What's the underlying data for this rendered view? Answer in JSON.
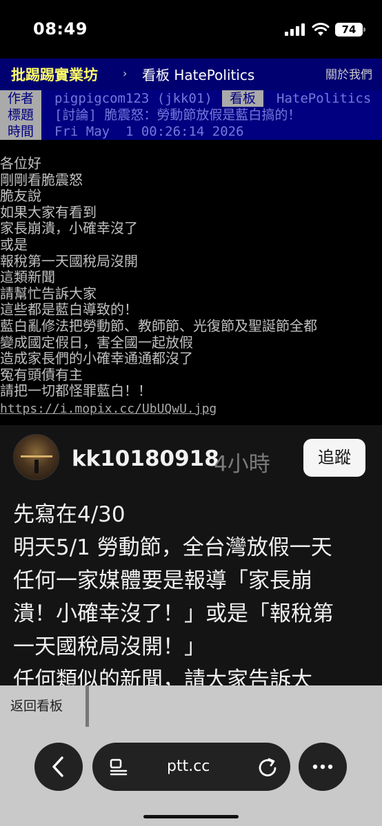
{
  "status": {
    "time": "08:49",
    "battery": "74"
  },
  "nav": {
    "brand": "批踢踢實業坊",
    "separator": "›",
    "board": "看板 HatePolitics",
    "about": "關於我們"
  },
  "meta": {
    "author_label": "作者",
    "author": "pigpigcom123 (jkk01)",
    "board_label": "看板",
    "board": "HatePolitics",
    "title_label": "標題",
    "title": "[討論] 脆震怒：勞動節放假是藍白搞的！",
    "time_label": "時間",
    "time": "Fri May  1 00:26:14 2026"
  },
  "article": {
    "lines": [
      "各位好",
      "剛剛看脆震怒",
      "脆友說",
      "如果大家有看到",
      "家長崩潰，小確幸沒了",
      "或是",
      "報稅第一天國稅局沒開",
      "這類新聞",
      "請幫忙告訴大家",
      "這些都是藍白導致的！",
      "藍白亂修法把勞動節、教師節、光復節及聖誕節全都",
      "變成國定假日，害全國一起放假",
      "造成家長們的小確幸通通都沒了",
      "冤有頭債有主",
      "請把一切都怪罪藍白！！"
    ],
    "link": "https://i.mopix.cc/UbUQwU.jpg"
  },
  "embed": {
    "username": "kk10180918",
    "time_ago": "4小時",
    "follow_label": "追蹤",
    "lines": [
      "先寫在4/30",
      "明天5/1 勞動節，全台灣放假一天",
      "任何一家媒體要是報導「家長崩",
      "潰！小確幸沒了！」或是「報稅第",
      "一天國稅局沒開！」",
      "任何類似的新聞，請大家告訴大"
    ]
  },
  "bottom": {
    "back_label": "返回看板"
  },
  "browser": {
    "url": "ptt.cc"
  },
  "icons": {
    "signal": "signal-icon",
    "wifi": "wifi-icon",
    "battery": "battery-icon",
    "back": "chevron-left-icon",
    "tabs": "page-menu-icon",
    "reload": "reload-icon",
    "more": "more-icon"
  },
  "colors": {
    "nav_bg": "#000070",
    "brand": "#ffff66",
    "meta_bg": "#000080",
    "meta_text": "#7777dd",
    "toolbar_bg": "#c9c9c9"
  }
}
